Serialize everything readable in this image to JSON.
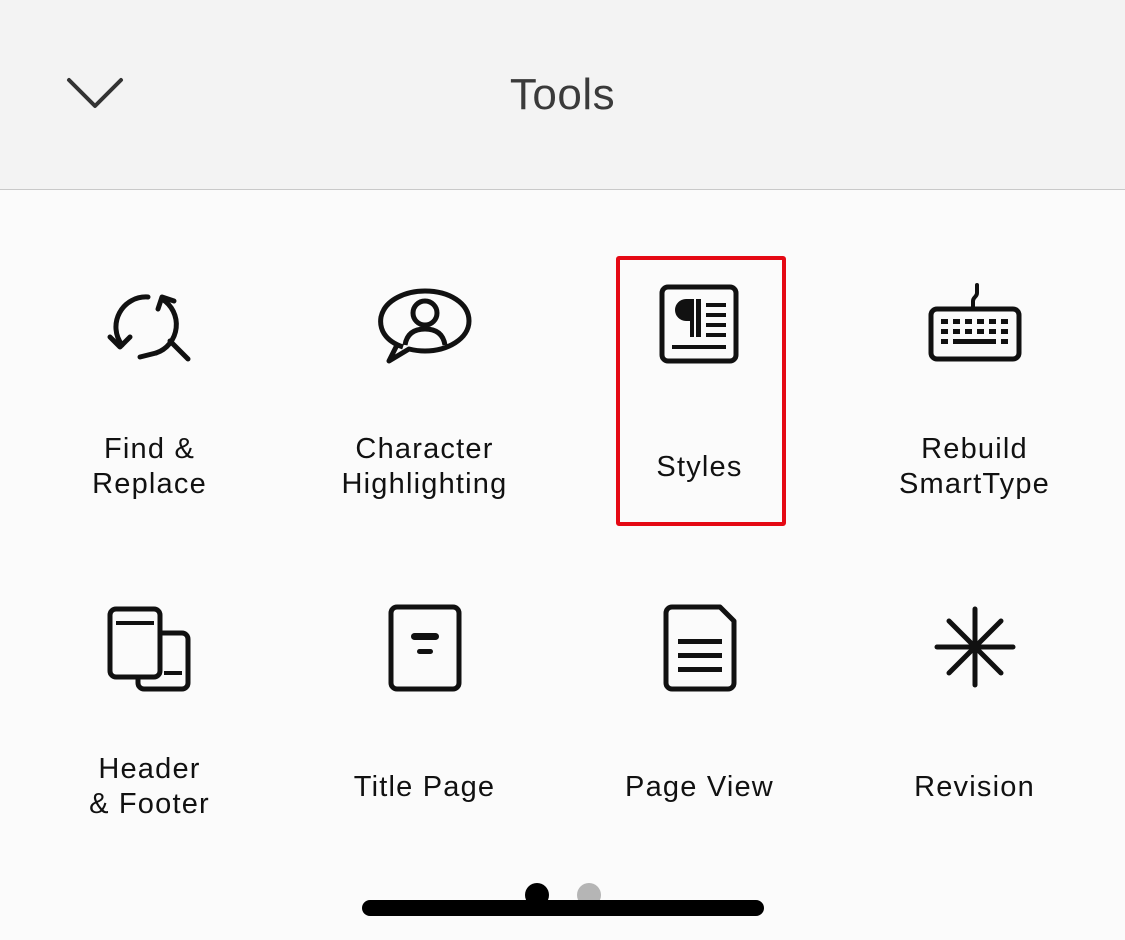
{
  "header": {
    "title": "Tools",
    "collapse_icon": "chevron-down-icon"
  },
  "tools": [
    {
      "label": "Find &\nReplace",
      "icon": "find-replace-icon"
    },
    {
      "label": "Character\nHighlighting",
      "icon": "character-highlighting-icon"
    },
    {
      "label": "Styles",
      "icon": "styles-icon",
      "highlighted": true
    },
    {
      "label": "Rebuild\nSmartType",
      "icon": "keyboard-icon"
    },
    {
      "label": "Header\n& Footer",
      "icon": "header-footer-icon"
    },
    {
      "label": "Title Page",
      "icon": "title-page-icon"
    },
    {
      "label": "Page View",
      "icon": "page-view-icon"
    },
    {
      "label": "Revision",
      "icon": "revision-asterisk-icon"
    }
  ],
  "pagination": {
    "current_page": 1,
    "total_pages": 2
  },
  "colors": {
    "highlight": "#e50914",
    "dot_active": "#000000",
    "dot_inactive": "#b5b5b5"
  }
}
